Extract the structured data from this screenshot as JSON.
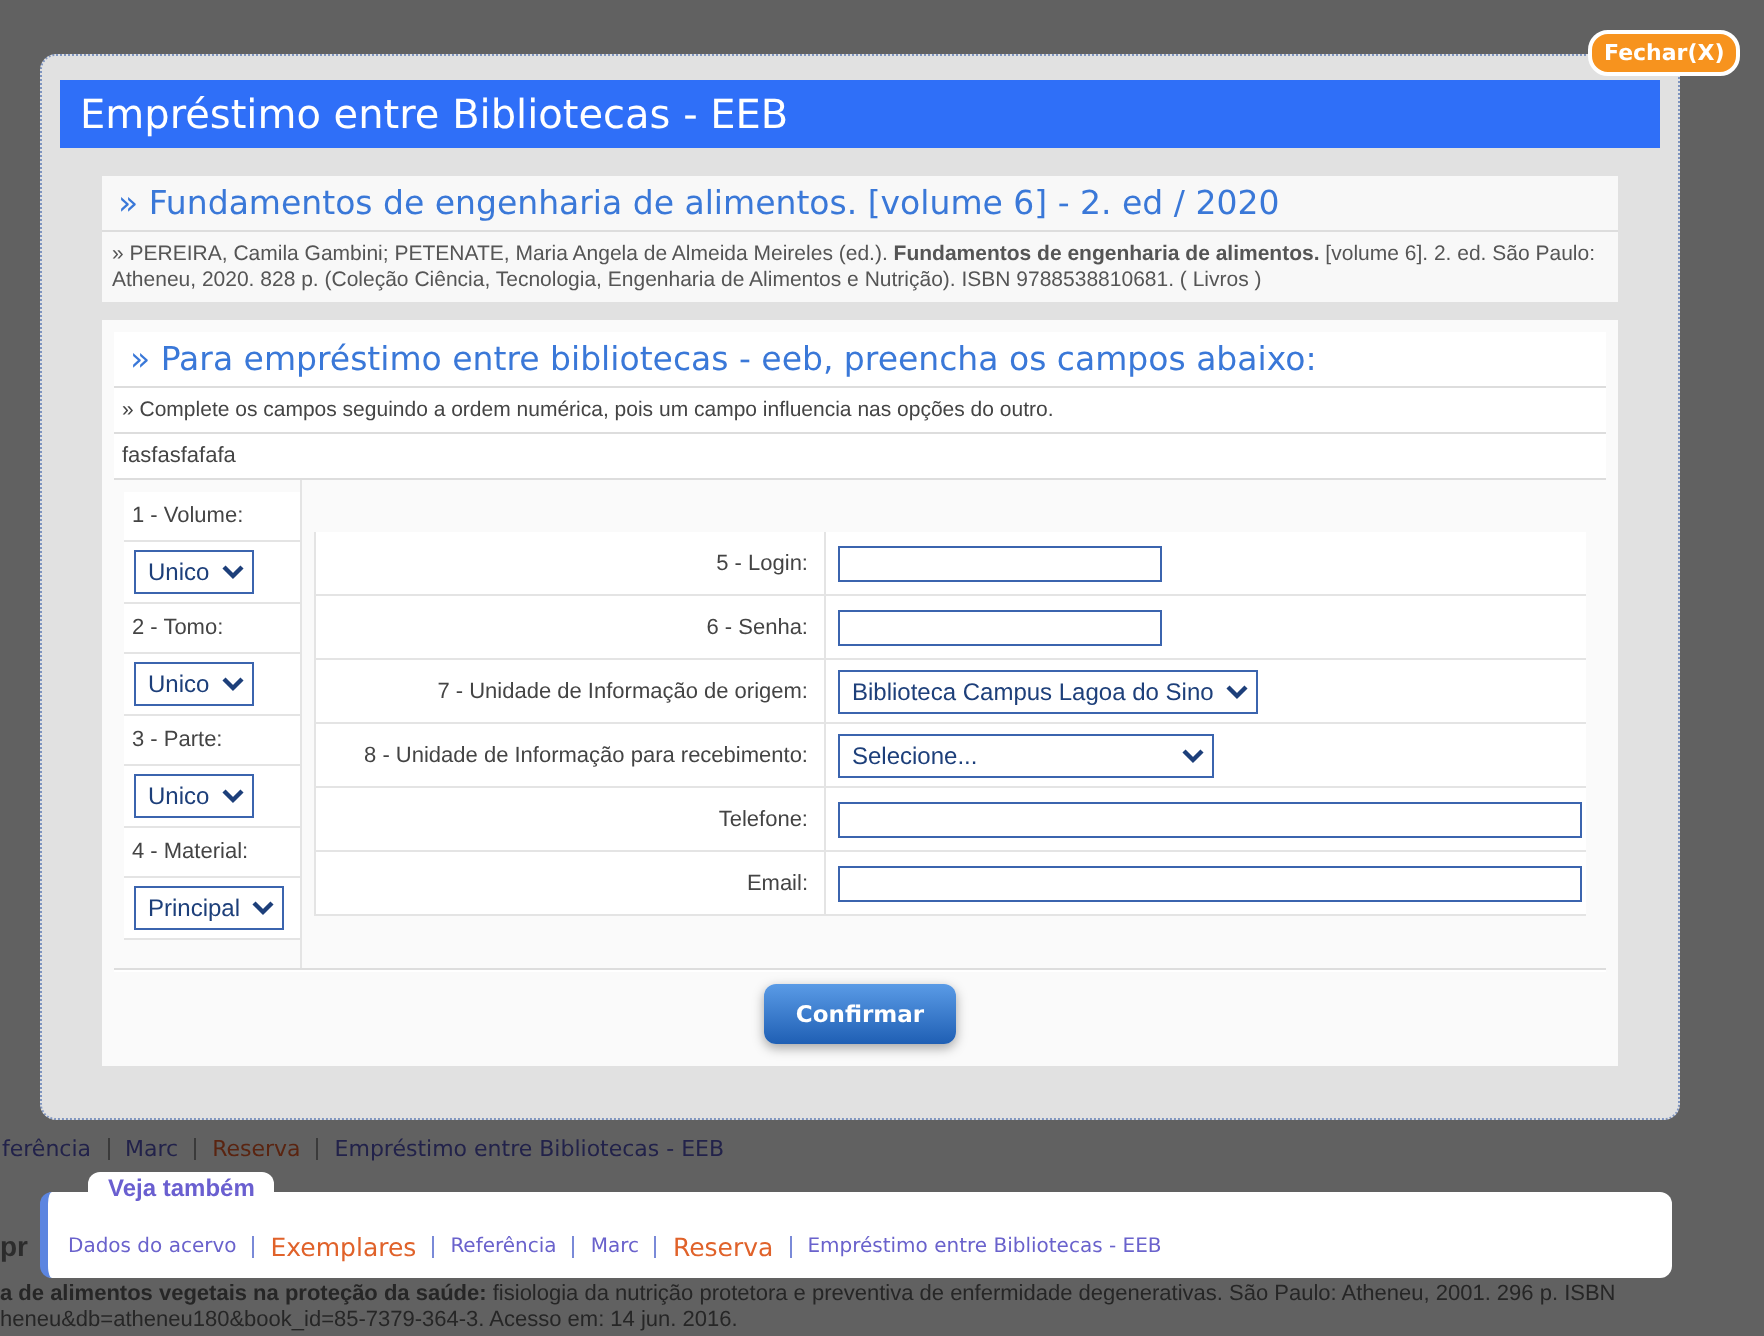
{
  "background": {
    "links": [
      {
        "label": "ferência",
        "kind": "plain"
      },
      {
        "label": "Marc",
        "kind": "plain"
      },
      {
        "label": "Reserva",
        "kind": "highlight"
      },
      {
        "label": "Empréstimo entre Bibliotecas - EEB",
        "kind": "plain"
      }
    ],
    "fragment": "pr",
    "lines": [
      "**a de alimentos vegetais na proteção da saúde:** fisiologia da nutrição protetora e preventiva de enfermidade degenerativas. São Paulo: Atheneu, 2001. 296 p. ISBN",
      "heneu&db=atheneu180&book_id=85-7379-364-3. Acesso em: 14 jun. 2016."
    ]
  },
  "modal": {
    "close_button": "Fechar(X)",
    "title": "Empréstimo entre Bibliotecas - EEB",
    "book": {
      "heading": "» Fundamentos de engenharia de alimentos. [volume 6] - 2. ed / 2020",
      "citation": "» PEREIRA, Camila Gambini; PETENATE, Maria Angela de Almeida Meireles (ed.). **Fundamentos de engenharia de alimentos.** [volume 6]. 2. ed. São Paulo: Atheneu, 2020. 828 p. (Coleção Ciência, Tecnologia, Engenharia de Alimentos e Nutrição). ISBN 9788538810681. ( Livros )"
    },
    "form": {
      "heading": "» Para empréstimo entre bibliotecas - eeb, preencha os campos abaixo:",
      "note": "» Complete os campos seguindo a ordem numérica, pois um campo influencia nas opções do outro.",
      "text": "fasfasfafafa",
      "left_fields": [
        {
          "label": "1 - Volume:",
          "value": "Unico"
        },
        {
          "label": "2 - Tomo:",
          "value": "Unico"
        },
        {
          "label": "3 - Parte:",
          "value": "Unico"
        },
        {
          "label": "4 - Material:",
          "value": "Principal"
        }
      ],
      "rows": [
        {
          "label": "5 - Login:",
          "kind": "short"
        },
        {
          "label": "6 - Senha:",
          "kind": "short"
        },
        {
          "label": "7 - Unidade de Informação de origem:",
          "kind": "select",
          "value": "Biblioteca Campus Lagoa do Sino"
        },
        {
          "label": "8 - Unidade de Informação para recebimento:",
          "kind": "select",
          "value": "Selecione..."
        },
        {
          "label": "Telefone:",
          "kind": "long"
        },
        {
          "label": "Email:",
          "kind": "long"
        }
      ],
      "submit": "Confirmar"
    }
  },
  "see_also": {
    "title": "Veja também",
    "links": [
      {
        "label": "Dados do acervo",
        "kind": "plain"
      },
      {
        "label": "Exemplares",
        "kind": "highlight"
      },
      {
        "label": "Referência",
        "kind": "plain"
      },
      {
        "label": "Marc",
        "kind": "plain"
      },
      {
        "label": "Reserva",
        "kind": "highlight"
      },
      {
        "label": "Empréstimo entre Bibliotecas - EEB",
        "kind": "plain"
      }
    ]
  }
}
